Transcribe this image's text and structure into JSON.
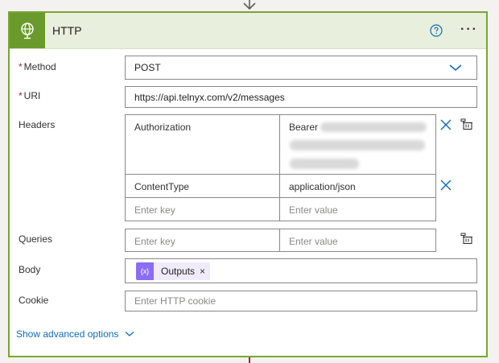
{
  "header": {
    "title": "HTTP"
  },
  "method": {
    "label": "Method",
    "required_mark": "*",
    "value": "POST"
  },
  "uri": {
    "label": "URI",
    "required_mark": "*",
    "value": "https://api.telnyx.com/v2/messages"
  },
  "headers": {
    "label": "Headers",
    "rows": [
      {
        "key": "Authorization",
        "value": "Bearer"
      },
      {
        "key": "ContentType",
        "value": "application/json"
      }
    ],
    "key_placeholder": "Enter key",
    "value_placeholder": "Enter value"
  },
  "queries": {
    "label": "Queries",
    "key_placeholder": "Enter key",
    "value_placeholder": "Enter value"
  },
  "body": {
    "label": "Body",
    "token": "Outputs",
    "token_close": "×"
  },
  "cookie": {
    "label": "Cookie",
    "placeholder": "Enter HTTP cookie"
  },
  "advanced": {
    "label": "Show advanced options"
  },
  "colors": {
    "accent_green": "#6b9a2c",
    "border_green": "#7aa535",
    "link_blue": "#0f6cbd",
    "token_purple": "#8c6cf2"
  }
}
